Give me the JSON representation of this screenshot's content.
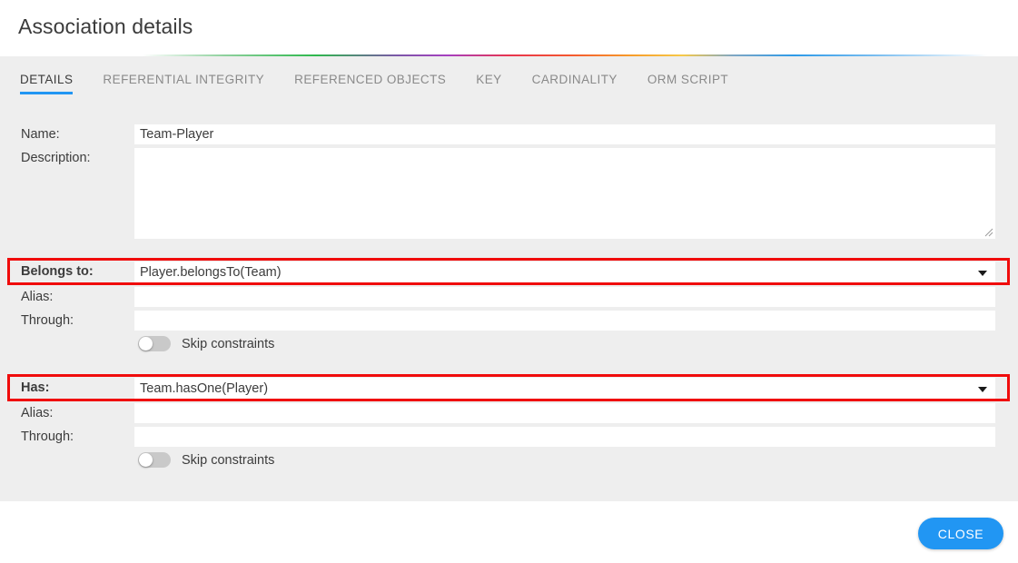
{
  "window": {
    "title": "Association details"
  },
  "tabs": [
    {
      "label": "DETAILS",
      "active": true
    },
    {
      "label": "REFERENTIAL INTEGRITY",
      "active": false
    },
    {
      "label": "REFERENCED OBJECTS",
      "active": false
    },
    {
      "label": "KEY",
      "active": false
    },
    {
      "label": "CARDINALITY",
      "active": false
    },
    {
      "label": "ORM SCRIPT",
      "active": false
    }
  ],
  "form": {
    "name": {
      "label": "Name:",
      "value": "Team-Player",
      "placeholder": ""
    },
    "description": {
      "label": "Description:",
      "value": "",
      "placeholder": ""
    },
    "belongs_to": {
      "label": "Belongs to:",
      "value": "Player.belongsTo(Team)",
      "highlighted": true,
      "alias": {
        "label": "Alias:",
        "value": "",
        "placeholder": ""
      },
      "through": {
        "label": "Through:",
        "value": "",
        "placeholder": ""
      },
      "skip_constraints": {
        "label": "Skip constraints",
        "on": false
      }
    },
    "has": {
      "label": "Has:",
      "value": "Team.hasOne(Player)",
      "highlighted": true,
      "alias": {
        "label": "Alias:",
        "value": "",
        "placeholder": ""
      },
      "through": {
        "label": "Through:",
        "value": "",
        "placeholder": ""
      },
      "skip_constraints": {
        "label": "Skip constraints",
        "on": false
      }
    }
  },
  "footer": {
    "close_label": "CLOSE"
  },
  "icons": {
    "caret": "chevron-down-icon",
    "grip": "resize-grip-icon"
  },
  "colors": {
    "accent": "#2196f3",
    "highlight": "#f00c0c",
    "panel": "#eeeeee",
    "text": "#3c3c3c",
    "muted": "#8a8a8a"
  }
}
